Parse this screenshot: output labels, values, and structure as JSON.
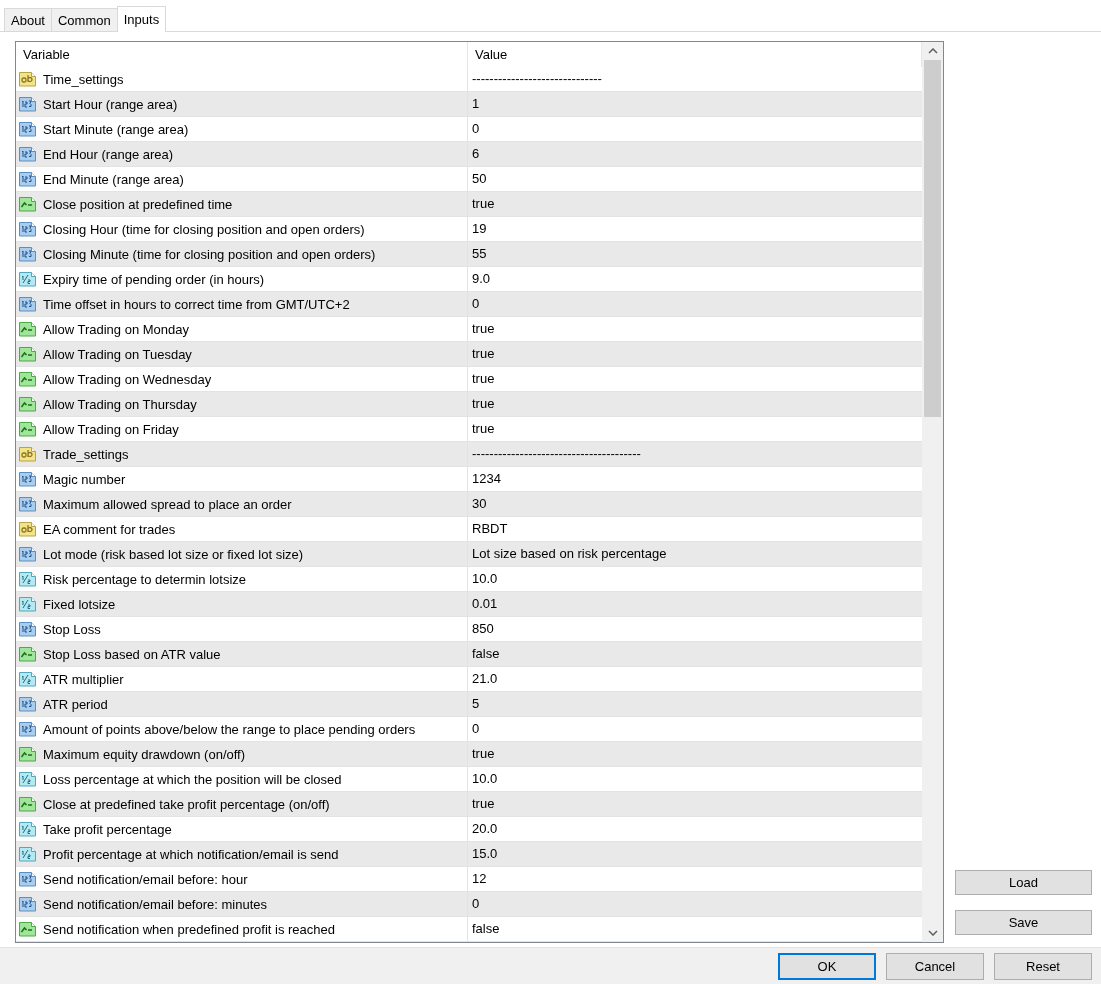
{
  "tabs": [
    {
      "label": "About",
      "selected": false
    },
    {
      "label": "Common",
      "selected": false
    },
    {
      "label": "Inputs",
      "selected": true
    }
  ],
  "inputs": {
    "columns": [
      "Variable",
      "Value"
    ],
    "rows": [
      {
        "kind": "text",
        "variable": "Time_settings",
        "value": "------------------------------"
      },
      {
        "kind": "int",
        "variable": "Start Hour (range area)",
        "value": "1"
      },
      {
        "kind": "int",
        "variable": "Start Minute (range area)",
        "value": "0"
      },
      {
        "kind": "int",
        "variable": "End Hour (range area)",
        "value": "6"
      },
      {
        "kind": "int",
        "variable": "End Minute (range area)",
        "value": "50"
      },
      {
        "kind": "bool",
        "variable": "Close position at predefined time",
        "value": "true"
      },
      {
        "kind": "int",
        "variable": "Closing Hour (time for closing position and open orders)",
        "value": "19"
      },
      {
        "kind": "int",
        "variable": "Closing Minute (time for closing position and open orders)",
        "value": "55"
      },
      {
        "kind": "double",
        "variable": "Expiry time of pending order (in hours)",
        "value": "9.0"
      },
      {
        "kind": "int",
        "variable": "Time offset in hours to correct time from GMT/UTC+2",
        "value": "0"
      },
      {
        "kind": "bool",
        "variable": "Allow Trading on Monday",
        "value": "true"
      },
      {
        "kind": "bool",
        "variable": "Allow Trading on Tuesday",
        "value": "true"
      },
      {
        "kind": "bool",
        "variable": "Allow Trading on Wednesday",
        "value": "true"
      },
      {
        "kind": "bool",
        "variable": "Allow Trading on Thursday",
        "value": "true"
      },
      {
        "kind": "bool",
        "variable": "Allow Trading on Friday",
        "value": "true"
      },
      {
        "kind": "text",
        "variable": "Trade_settings",
        "value": "---------------------------------------"
      },
      {
        "kind": "int",
        "variable": "Magic number",
        "value": "1234"
      },
      {
        "kind": "int",
        "variable": "Maximum allowed spread to place an order",
        "value": "30"
      },
      {
        "kind": "text",
        "variable": "EA comment for trades",
        "value": "RBDT"
      },
      {
        "kind": "int",
        "variable": "Lot mode (risk based lot size or fixed lot size)",
        "value": "Lot size based on risk percentage"
      },
      {
        "kind": "double",
        "variable": "Risk percentage to determin lotsize",
        "value": "10.0"
      },
      {
        "kind": "double",
        "variable": "Fixed lotsize",
        "value": "0.01"
      },
      {
        "kind": "int",
        "variable": "Stop Loss",
        "value": "850"
      },
      {
        "kind": "bool",
        "variable": "Stop Loss based on ATR value",
        "value": "false"
      },
      {
        "kind": "double",
        "variable": "ATR multiplier",
        "value": "21.0"
      },
      {
        "kind": "int",
        "variable": "ATR period",
        "value": "5"
      },
      {
        "kind": "int",
        "variable": "Amount of points above/below the range to place pending orders",
        "value": "0"
      },
      {
        "kind": "bool",
        "variable": "Maximum equity drawdown (on/off)",
        "value": "true"
      },
      {
        "kind": "double",
        "variable": "Loss percentage at which the position will be closed",
        "value": "10.0"
      },
      {
        "kind": "bool",
        "variable": "Close at predefined take profit percentage (on/off)",
        "value": "true"
      },
      {
        "kind": "double",
        "variable": "Take profit percentage",
        "value": "20.0"
      },
      {
        "kind": "double",
        "variable": "Profit percentage at which notification/email is send",
        "value": "15.0"
      },
      {
        "kind": "int",
        "variable": "Send notification/email before: hour",
        "value": "12"
      },
      {
        "kind": "int",
        "variable": "Send notification/email before: minutes",
        "value": "0"
      },
      {
        "kind": "bool",
        "variable": "Send notification when predefined profit is reached",
        "value": "false"
      }
    ]
  },
  "side_buttons": [
    "Load",
    "Save"
  ],
  "buttons": [
    {
      "label": "OK",
      "default": true
    },
    {
      "label": "Cancel",
      "default": false
    },
    {
      "label": "Reset",
      "default": false
    }
  ]
}
